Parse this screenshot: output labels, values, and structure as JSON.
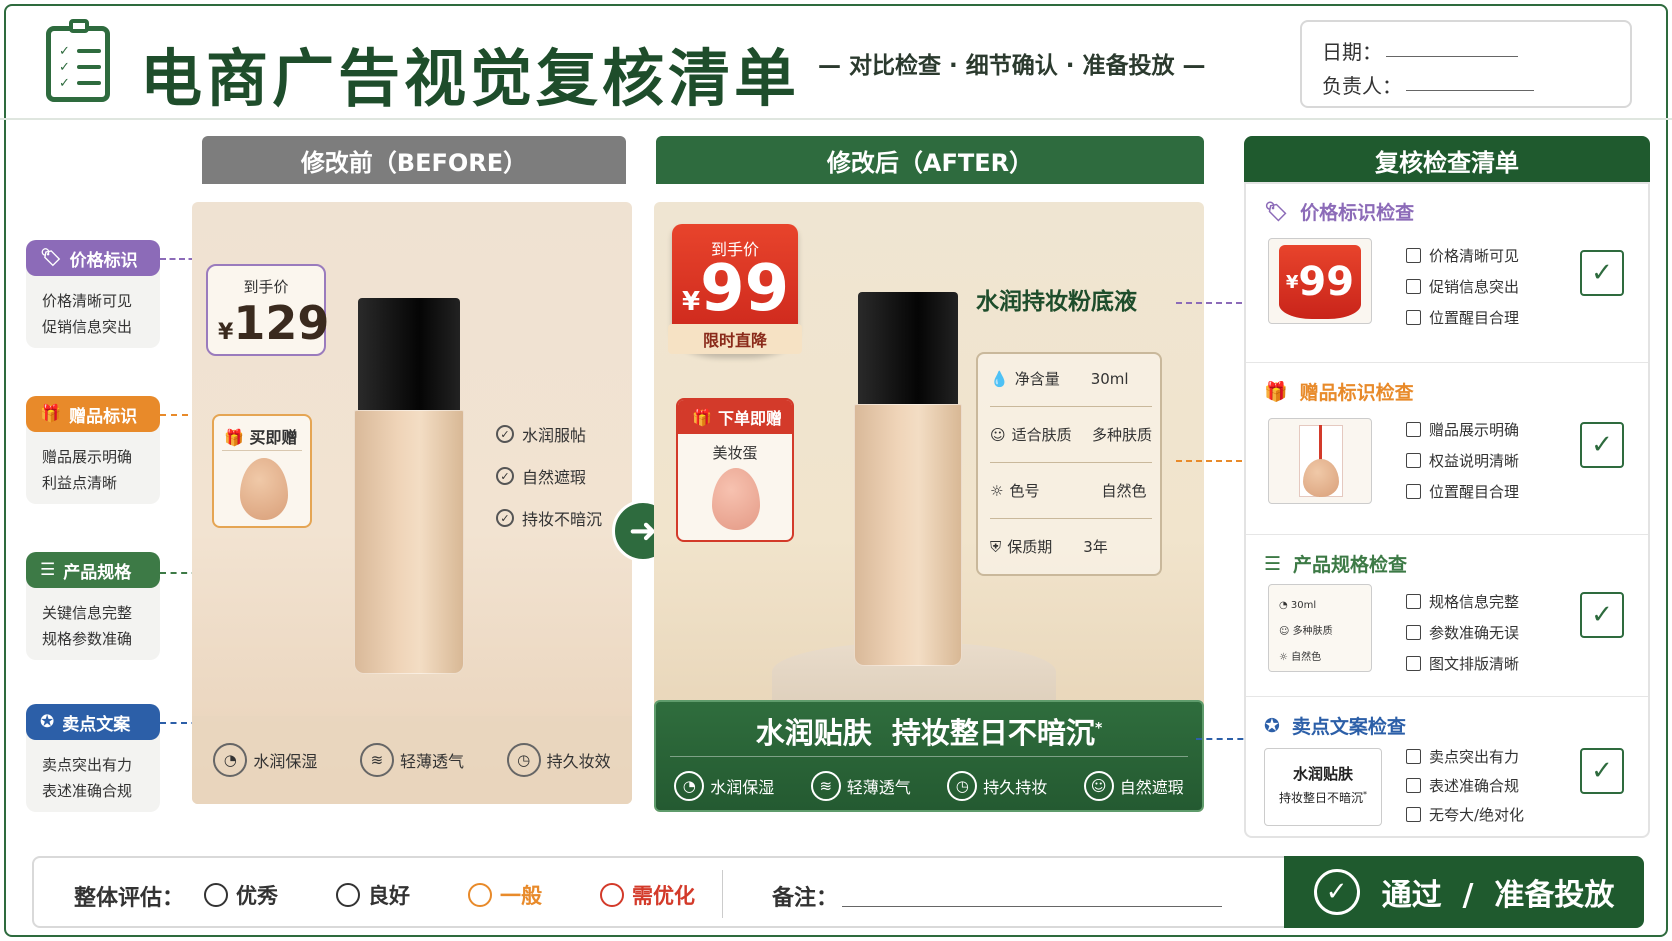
{
  "header": {
    "title": "电商广告视觉复核清单",
    "subtitle": "— 对比检查 · 细节确认 · 准备投放 —",
    "date_label": "日期：",
    "owner_label": "负责人："
  },
  "left_tags": [
    {
      "label": "价格标识",
      "lines": [
        "价格清晰可见",
        "促销信息突出"
      ],
      "color": "#8c6bb8",
      "icon": "price-tag-icon"
    },
    {
      "label": "赠品标识",
      "lines": [
        "赠品展示明确",
        "利益点清晰"
      ],
      "color": "#e88a2a",
      "icon": "gift-icon"
    },
    {
      "label": "产品规格",
      "lines": [
        "关键信息完整",
        "规格参数准确"
      ],
      "color": "#3d7a46",
      "icon": "list-icon"
    },
    {
      "label": "卖点文案",
      "lines": [
        "卖点突出有力",
        "表述准确合规"
      ],
      "color": "#2c5fa8",
      "icon": "shield-icon"
    }
  ],
  "before": {
    "header": "修改前（BEFORE）",
    "price_label": "到手价",
    "currency": "¥",
    "price": "129",
    "gift_label": "买即赠",
    "checks": [
      "水润服帖",
      "自然遮瑕",
      "持妆不暗沉"
    ],
    "features": [
      "水润保湿",
      "轻薄透气",
      "持久妆效"
    ]
  },
  "after": {
    "header": "修改后（AFTER）",
    "price_label": "到手价",
    "currency": "¥",
    "price": "99",
    "price_tag": "限时直降",
    "gift_label": "下单即赠",
    "gift_item": "美妆蛋",
    "product_name": "水润持妆粉底液",
    "specs": [
      {
        "key": "净含量",
        "value": "30ml",
        "icon": "drop-icon"
      },
      {
        "key": "适合肤质",
        "value": "多种肤质",
        "icon": "face-icon"
      },
      {
        "key": "色号",
        "value": "自然色",
        "icon": "sun-icon"
      },
      {
        "key": "保质期",
        "value": "3年",
        "icon": "shield-icon"
      }
    ],
    "slogan": "水润贴肤  持妆整日不暗沉",
    "slogan_mark": "*",
    "features": [
      "水润保湿",
      "轻薄透气",
      "持久持妆",
      "自然遮瑕"
    ]
  },
  "checklist": {
    "header": "复核检查清单",
    "sections": [
      {
        "title": "价格标识检查",
        "items": [
          "价格清晰可见",
          "促销信息突出",
          "位置醒目合理"
        ],
        "color": "#8c6bb8",
        "icon": "price-tag-icon"
      },
      {
        "title": "赠品标识检查",
        "items": [
          "赠品展示明确",
          "权益说明清晰",
          "位置醒目合理"
        ],
        "color": "#e88a2a",
        "icon": "gift-icon"
      },
      {
        "title": "产品规格检查",
        "items": [
          "规格信息完整",
          "参数准确无误",
          "图文排版清晰"
        ],
        "color": "#3d7a46",
        "icon": "list-icon"
      },
      {
        "title": "卖点文案检查",
        "items": [
          "卖点突出有力",
          "表述准确合规",
          "无夸大/绝对化"
        ],
        "color": "#2c5fa8",
        "icon": "shield-icon"
      }
    ],
    "thumb_price": "99",
    "thumb_currency": "¥",
    "thumb_specs": [
      "30ml",
      "多种肤质",
      "自然色"
    ],
    "thumb_slogan_1": "水润贴肤",
    "thumb_slogan_2": "持妆整日不暗沉",
    "thumb_slogan_mark": "*"
  },
  "bottom": {
    "eval_label": "整体评估：",
    "options": [
      {
        "label": "优秀",
        "color": "#333333"
      },
      {
        "label": "良好",
        "color": "#333333"
      },
      {
        "label": "一般",
        "color": "#e88a2a"
      },
      {
        "label": "需优化",
        "color": "#d33a2a"
      }
    ],
    "note_label": "备注：",
    "pass_text": "通过  /  准备投放"
  }
}
